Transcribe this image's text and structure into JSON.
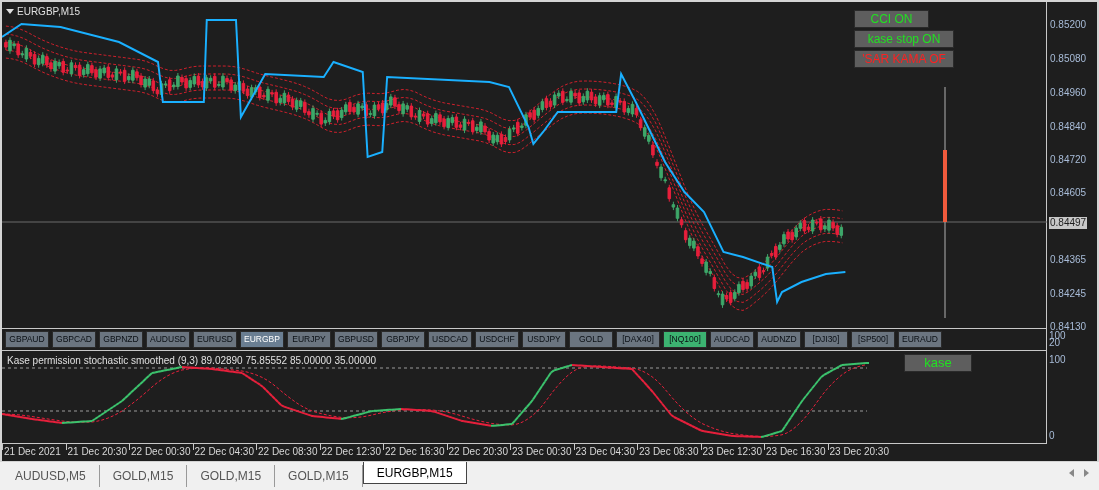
{
  "chart": {
    "title": "EURGBP,M15",
    "buttons": [
      {
        "label": "CCI ON",
        "on": true
      },
      {
        "label": "kase stop ON",
        "on": true
      },
      {
        "label": "'SAR KAMA OF",
        "on": false
      }
    ],
    "price_axis": [
      {
        "label": "0.85200",
        "current": false
      },
      {
        "label": "0.85080",
        "current": false
      },
      {
        "label": "0.84960",
        "current": false
      },
      {
        "label": "0.84840",
        "current": false
      },
      {
        "label": "0.84720",
        "current": false
      },
      {
        "label": "0.84605",
        "current": false
      },
      {
        "label": "0.84497",
        "current": true
      },
      {
        "label": "0.84365",
        "current": false
      },
      {
        "label": "0.84245",
        "current": false
      },
      {
        "label": "0.84130",
        "current": false
      }
    ]
  },
  "symbols": [
    {
      "label": "GBPAUD",
      "selected": false,
      "highlighted": false
    },
    {
      "label": "GBPCAD",
      "selected": false,
      "highlighted": false
    },
    {
      "label": "GBPNZD",
      "selected": false,
      "highlighted": false
    },
    {
      "label": "AUDUSD",
      "selected": false,
      "highlighted": false
    },
    {
      "label": "EURUSD",
      "selected": false,
      "highlighted": false
    },
    {
      "label": "EURGBP",
      "selected": true,
      "highlighted": false
    },
    {
      "label": "EURJPY",
      "selected": false,
      "highlighted": false
    },
    {
      "label": "GBPUSD",
      "selected": false,
      "highlighted": false
    },
    {
      "label": "GBPJPY",
      "selected": false,
      "highlighted": false
    },
    {
      "label": "USDCAD",
      "selected": false,
      "highlighted": false
    },
    {
      "label": "USDCHF",
      "selected": false,
      "highlighted": false
    },
    {
      "label": "USDJPY",
      "selected": false,
      "highlighted": false
    },
    {
      "label": "GOLD",
      "selected": false,
      "highlighted": false
    },
    {
      "label": "[DAX40]",
      "selected": false,
      "highlighted": false
    },
    {
      "label": "[NQ100]",
      "selected": false,
      "highlighted": true
    },
    {
      "label": "AUDCAD",
      "selected": false,
      "highlighted": false
    },
    {
      "label": "AUDNZD",
      "selected": false,
      "highlighted": false
    },
    {
      "label": "[DJI30]",
      "selected": false,
      "highlighted": false
    },
    {
      "label": "[SP500]",
      "selected": false,
      "highlighted": false
    },
    {
      "label": "EURAUD",
      "selected": false,
      "highlighted": false
    }
  ],
  "symbol_axis": [
    "100",
    "20"
  ],
  "indicator": {
    "title": "Kase permission stochastic smoothed (9,3) 89.02890 75.85552 85.00000 35.00000",
    "button": "kase",
    "axis": [
      "100",
      "0"
    ]
  },
  "time_axis": [
    "21 Dec 2021",
    "21 Dec 20:30",
    "22 Dec 00:30",
    "22 Dec 04:30",
    "22 Dec 08:30",
    "22 Dec 12:30",
    "22 Dec 16:30",
    "22 Dec 20:30",
    "23 Dec 00:30",
    "23 Dec 04:30",
    "23 Dec 08:30",
    "23 Dec 12:30",
    "23 Dec 16:30",
    "23 Dec 20:30"
  ],
  "tabs": [
    {
      "label": "AUDUSD,M5",
      "selected": false
    },
    {
      "label": "GOLD,M15",
      "selected": false
    },
    {
      "label": "GOLD,M15",
      "selected": false
    },
    {
      "label": "GOLD,M15",
      "selected": false
    },
    {
      "label": "EURGBP,M15",
      "selected": true
    }
  ]
}
